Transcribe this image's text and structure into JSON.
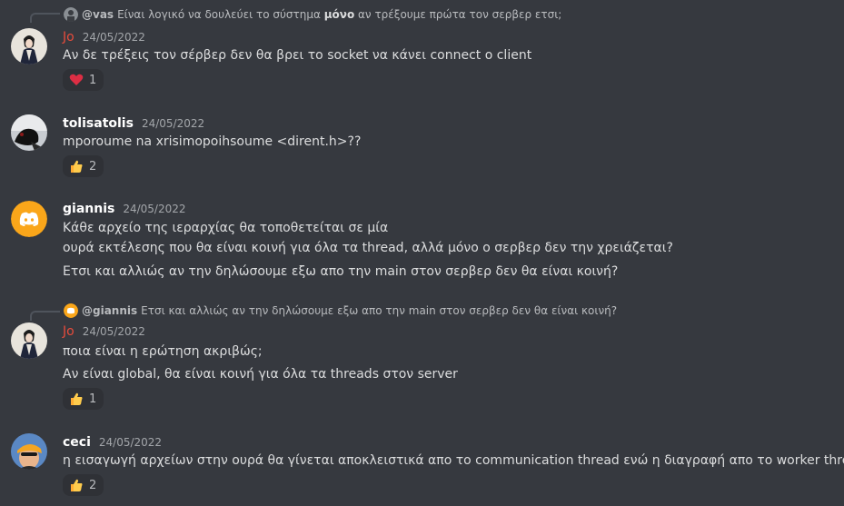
{
  "messages": [
    {
      "reply": {
        "mention": "@vas",
        "text_before": "Είναι λογικό να δουλεύει το σύστημα ",
        "text_bold": "μόνο",
        "text_after": " αν τρέξουμε πρώτα τον σερβερ ετσι;"
      },
      "author": "Jo",
      "timestamp": "24/05/2022",
      "lines": [
        "Αν δε τρέξεις τον σέρβερ δεν θα βρει το socket να κάνει connect ο client"
      ],
      "reaction": {
        "emoji": "heart-icon",
        "count": "1"
      }
    },
    {
      "author": "tolisatolis",
      "timestamp": "24/05/2022",
      "lines": [
        "mporoume na xrisimopoihsoume  <dirent.h>??"
      ],
      "reaction": {
        "emoji": "thumbs-up-icon",
        "count": "2"
      }
    },
    {
      "author": "giannis",
      "timestamp": "24/05/2022",
      "lines": [
        "Κάθε αρχείο της ιεραρχίας θα τοποθετείται σε μία",
        "ουρά εκτέλεσης που θα είναι κοινή για όλα τα thread, αλλά μόνο ο σερβερ δεν την χρειάζεται?",
        "Ετσι και αλλιώς αν την δηλώσουμε εξω απο την main στον σερβερ δεν θα είναι κοινή?"
      ]
    },
    {
      "reply": {
        "mention": "@giannis",
        "text_before": "Ετσι και αλλιώς αν την δηλώσουμε εξω απο την main στον σερβερ δεν θα είναι κοινή?",
        "text_bold": "",
        "text_after": ""
      },
      "author": "Jo",
      "timestamp": "24/05/2022",
      "lines": [
        "ποια είναι η ερώτηση ακριβώς;",
        "Αν είναι global, θα είναι κοινή για όλα τα threads στον server"
      ],
      "reaction": {
        "emoji": "thumbs-up-icon",
        "count": "1"
      }
    },
    {
      "author": "ceci",
      "timestamp": "24/05/2022",
      "lines": [
        "η εισαγωγή αρχείων στην ουρά θα γίνεται αποκλειστικά απο το communication thread ενώ η διαγραφή απο το worker thread;"
      ],
      "reaction": {
        "emoji": "thumbs-up-icon",
        "count": "2"
      }
    }
  ],
  "colors": {
    "background": "#36393f",
    "username_default": "#ffffff",
    "username_jo": "#e74c3c",
    "discord_blurple": "#faa61a",
    "reaction_bg": "#2f3136"
  }
}
